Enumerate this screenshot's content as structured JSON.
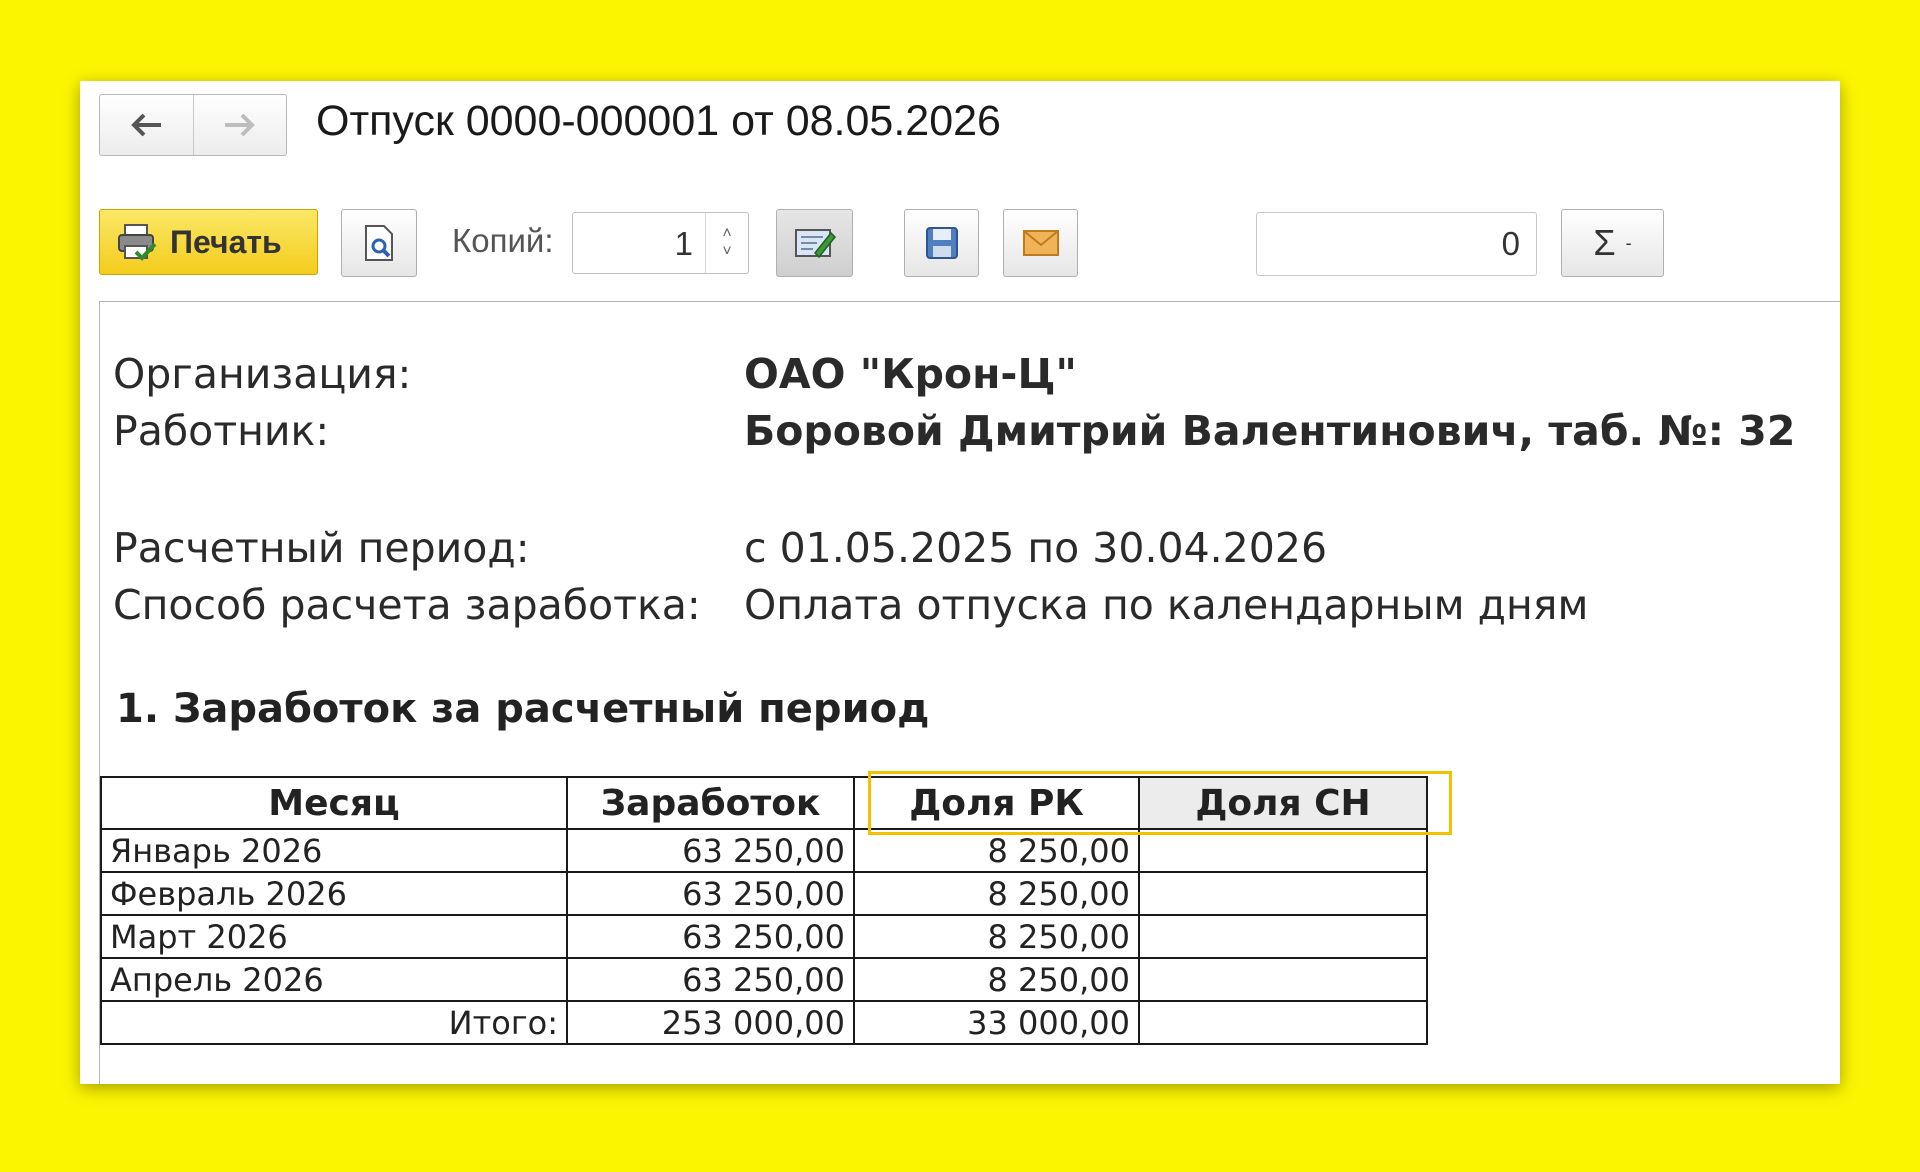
{
  "window": {
    "title": "Отпуск 0000-000001 от 08.05.2026",
    "nav": {
      "back_icon": "arrow-left-icon",
      "forward_icon": "arrow-right-icon"
    }
  },
  "toolbar": {
    "print_label": "Печать",
    "copies_label": "Копий:",
    "copies_value": "1",
    "sum_value": "0",
    "sigma_label": "Σ",
    "sigma_caret": "-",
    "icons": [
      "printer-icon",
      "preview-icon",
      "edit-icon",
      "save-icon",
      "mail-icon"
    ]
  },
  "document": {
    "organization_label": "Организация:",
    "organization_value": "ОАО \"Крон-Ц\"",
    "employee_label": "Работник:",
    "employee_value": "Боровой Дмитрий Валентинович, таб. №: 32",
    "period_label": "Расчетный период:",
    "period_value": "с 01.05.2025 по 30.04.2026",
    "method_label": "Способ расчета заработка:",
    "method_value": "Оплата отпуска по календарным дням",
    "section_title": "1. Заработок за расчетный период",
    "table": {
      "headers": [
        "Месяц",
        "Заработок",
        "Доля РК",
        "Доля СН"
      ],
      "rows": [
        [
          "Январь 2026",
          "63 250,00",
          "8 250,00",
          ""
        ],
        [
          "Февраль 2026",
          "63 250,00",
          "8 250,00",
          ""
        ],
        [
          "Март 2026",
          "63 250,00",
          "8 250,00",
          ""
        ],
        [
          "Апрель 2026",
          "63 250,00",
          "8 250,00",
          ""
        ]
      ],
      "total": [
        "Итого:",
        "253 000,00",
        "33 000,00",
        ""
      ]
    }
  },
  "colors": {
    "background": "#fcf500",
    "print_button": "#f3cc1c",
    "highlight_border": "#f2c200"
  }
}
